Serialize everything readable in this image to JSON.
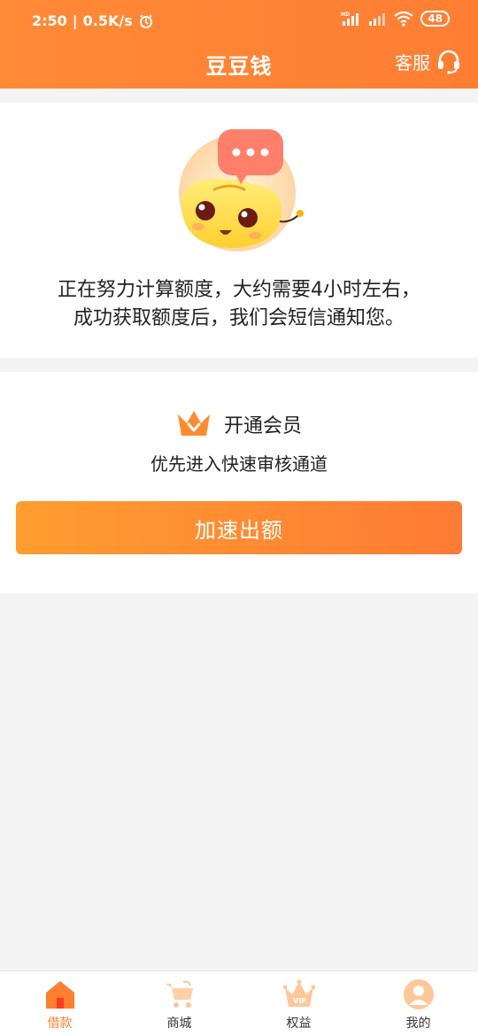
{
  "status_bar": {
    "time": "2:50",
    "network_speed": "0.5K/s",
    "battery": "48",
    "icons": [
      "alarm-icon",
      "hd-signal-icon",
      "signal-icon",
      "wifi-icon",
      "battery-icon"
    ]
  },
  "header": {
    "title": "豆豆钱",
    "service_label": "客服",
    "service_icon": "headset-icon"
  },
  "status_card": {
    "mascot": "mascot-illustration",
    "line1": "正在努力计算额度，大约需要4小时左右，",
    "line2": "成功获取额度后，我们会短信通知您。"
  },
  "vip_card": {
    "title": "开通会员",
    "subtitle": "优先进入快速审核通道",
    "button_label": "加速出额",
    "icon": "crown-icon"
  },
  "tabbar": {
    "items": [
      {
        "label": "借款",
        "icon": "home-icon",
        "active": true
      },
      {
        "label": "商城",
        "icon": "cart-icon",
        "active": false
      },
      {
        "label": "权益",
        "icon": "vip-crown-icon",
        "active": false
      },
      {
        "label": "我的",
        "icon": "profile-icon",
        "active": false
      }
    ]
  },
  "colors": {
    "accent": "#ff7f30",
    "header_bg": "#ff8a36",
    "page_bg": "#f4f4f4"
  }
}
